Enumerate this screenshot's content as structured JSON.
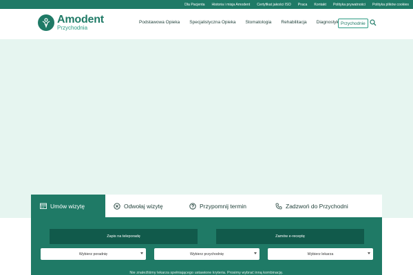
{
  "topbar": {
    "links": [
      "Dla Pacjenta",
      "Historia i misja Amodent",
      "Certyfikat jakości ISO",
      "Praca",
      "Kontakt",
      "Polityka prywatności",
      "Polityka plików cookies"
    ]
  },
  "logo": {
    "title": "Amodent",
    "subtitle": "Przychodnia"
  },
  "nav": {
    "items": [
      "Podstawowa Opieka",
      "Specjalistyczna Opieka",
      "Stomatologia",
      "Rehabilitacja",
      "Diagnostyka"
    ],
    "button_label": "Przychodnie",
    "search_icon": "search-icon"
  },
  "tabs": [
    {
      "label": "Umów wizytę",
      "icon": "calendar-icon"
    },
    {
      "label": "Odwołaj wizytę",
      "icon": "cancel-circle-icon"
    },
    {
      "label": "Przypomnij termin",
      "icon": "question-circle-icon"
    },
    {
      "label": "Zadzwoń do Przychodni",
      "icon": "phone-icon"
    }
  ],
  "panel": {
    "teleporada_label": "Zapis na teleporadę",
    "erecepta_label": "Zamów e-receptę",
    "selects": [
      "Wybierz poradnię",
      "Wybierz przychodnię",
      "Wybierz lekarza"
    ],
    "notice": "Nie znaleźliśmy lekarza spełniającego ustawione kryteria. Prosimy wybrać inną kombinację."
  },
  "colors": {
    "brand": "#1f7a66",
    "brand_dark": "#115a4b",
    "hero_bg": "#e6f5f0"
  }
}
